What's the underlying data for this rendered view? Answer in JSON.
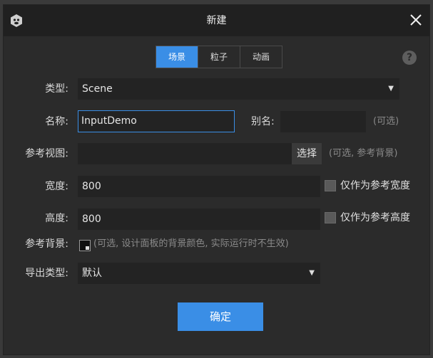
{
  "window": {
    "title": "新建"
  },
  "tabs": [
    {
      "label": "场景",
      "active": true
    },
    {
      "label": "粒子",
      "active": false
    },
    {
      "label": "动画",
      "active": false
    }
  ],
  "help": {
    "symbol": "?"
  },
  "form": {
    "type": {
      "label": "类型:",
      "value": "Scene"
    },
    "name": {
      "label": "名称:",
      "value": "InputDemo"
    },
    "alias": {
      "label": "别名:",
      "value": "",
      "hint": "(可选)"
    },
    "ref_view": {
      "label": "参考视图:",
      "value": "",
      "button": "选择",
      "hint": "(可选, 参考背景)"
    },
    "width": {
      "label": "宽度:",
      "value": "800",
      "checkbox_label": "仅作为参考宽度"
    },
    "height": {
      "label": "高度:",
      "value": "800",
      "checkbox_label": "仅作为参考高度"
    },
    "ref_bg": {
      "label": "参考背景:",
      "hint": "(可选, 设计面板的背景颜色, 实际运行时不生效)"
    },
    "export_type": {
      "label": "导出类型:",
      "value": "默认"
    }
  },
  "footer": {
    "ok_label": "确定"
  },
  "colors": {
    "accent": "#3a8ee6",
    "background": "#2b2b2b",
    "titlebar": "#202020",
    "field": "#232323"
  }
}
